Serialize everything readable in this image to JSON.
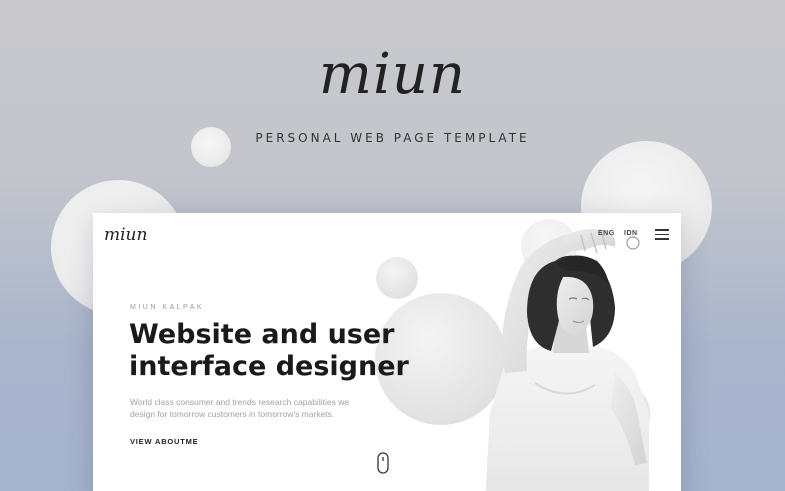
{
  "brand": {
    "logo_text": "miun",
    "tagline": "PERSONAL WEB PAGE TEMPLATE"
  },
  "mockup": {
    "logo_text": "miun",
    "nav": {
      "lang_eng": "ENG",
      "lang_idn": "IDN",
      "menu_icon": "hamburger-menu-icon"
    },
    "hero": {
      "eyebrow": "MIUN KALPAK",
      "headline_line1": "Website and user",
      "headline_line2": "interface designer",
      "description_line1": "World class consumer and trends research capabilities we",
      "description_line2": "design for tomorrow customers in tomorrow's markets.",
      "cta_label": "VIEW ABOUTME",
      "scroll_icon": "mouse-scroll-icon"
    }
  },
  "colors": {
    "background_top": "#c9c9cd",
    "background_bottom": "#a5b3cf",
    "text_dark": "#1a1a1a",
    "text_muted": "#a2a2a2"
  }
}
